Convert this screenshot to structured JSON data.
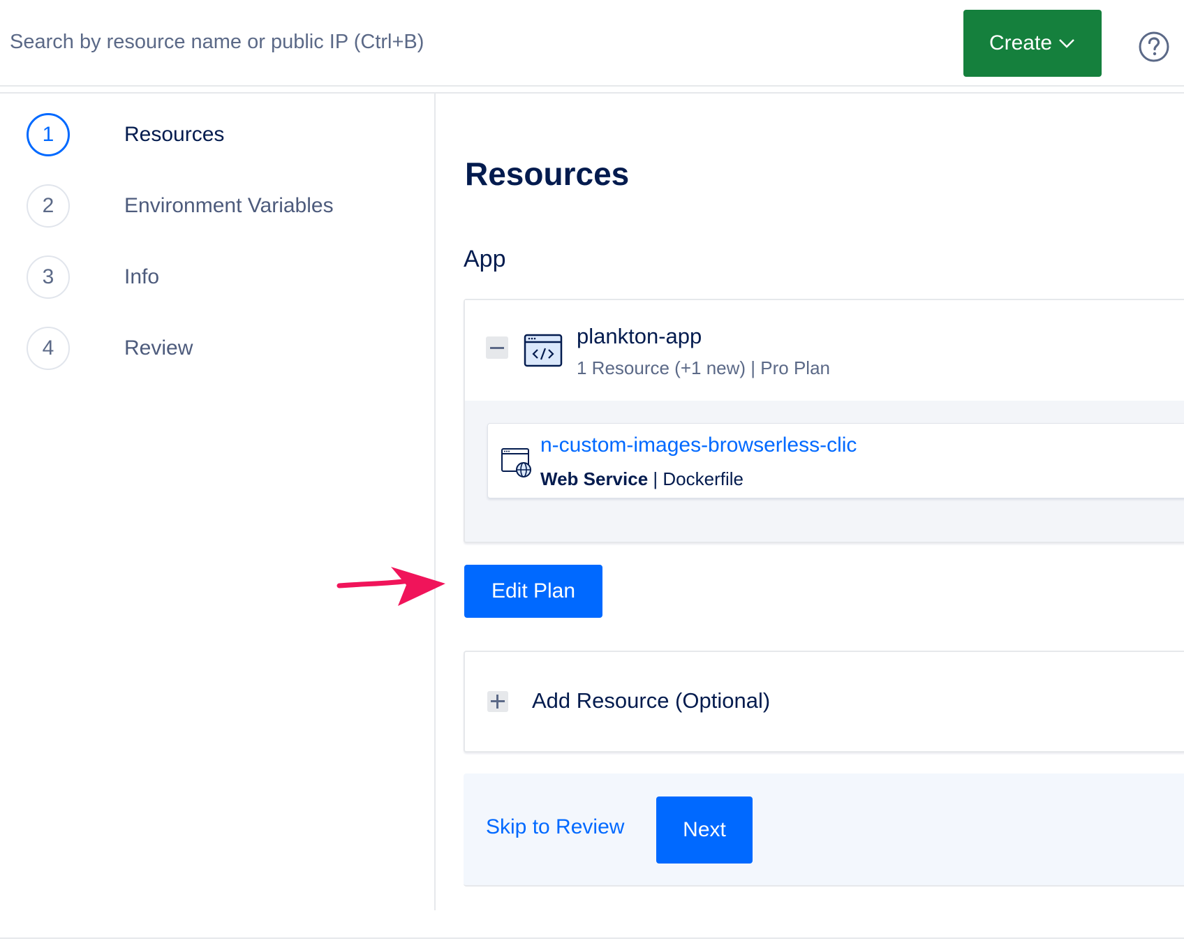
{
  "topbar": {
    "search_placeholder": "Search by resource name or public IP (Ctrl+B)",
    "create_label": "Create"
  },
  "stepper": {
    "steps": [
      {
        "number": "1",
        "label": "Resources",
        "active": true
      },
      {
        "number": "2",
        "label": "Environment Variables",
        "active": false
      },
      {
        "number": "3",
        "label": "Info",
        "active": false
      },
      {
        "number": "4",
        "label": "Review",
        "active": false
      }
    ]
  },
  "main": {
    "title": "Resources",
    "section_title": "App",
    "app": {
      "name": "plankton-app",
      "meta": "1 Resource (+1 new) | Pro Plan",
      "component": {
        "name": "n-custom-images-browserless-clic",
        "type": "Web Service",
        "source": "Dockerfile"
      }
    },
    "edit_plan_label": "Edit Plan",
    "add_resource_label": "Add Resource (Optional)",
    "footer": {
      "skip_label": "Skip to Review",
      "next_label": "Next"
    }
  },
  "colors": {
    "primary": "#0069ff",
    "create": "#15803d",
    "annotation_arrow": "#f0145a"
  }
}
